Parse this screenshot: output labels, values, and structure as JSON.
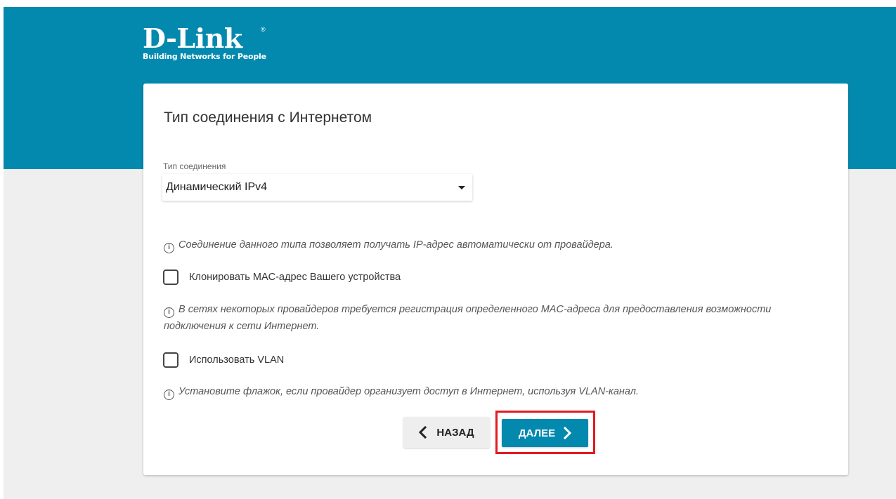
{
  "colors": {
    "brand": "#0389ae",
    "highlight": "#e11b22",
    "page_background": "#efefef"
  },
  "logo": {
    "name": "D-Link",
    "registered_mark": "®",
    "tagline": "Building Networks for People"
  },
  "card": {
    "title": "Тип соединения с Интернетом",
    "connection_type": {
      "label": "Тип соединения",
      "selected": "Динамический IPv4",
      "icon": "caret-down-icon"
    },
    "info_icon": "info-icon",
    "info_connection": "Соединение данного типа позволяет получать IP-адрес автоматически от провайдера.",
    "clone_mac": {
      "label": "Клонировать MAC-адрес Вашего устройства",
      "checked": false
    },
    "info_mac": "В сетях некоторых провайдеров требуется регистрация определенного MAC-адреса для предоставления возможности подключения к сети Интернет.",
    "use_vlan": {
      "label": "Использовать VLAN",
      "checked": false
    },
    "info_vlan": "Установите флажок, если провайдер организует доступ в Интернет, используя VLAN-канал.",
    "buttons": {
      "back_label": "НАЗАД",
      "next_label": "ДАЛЕЕ"
    }
  }
}
